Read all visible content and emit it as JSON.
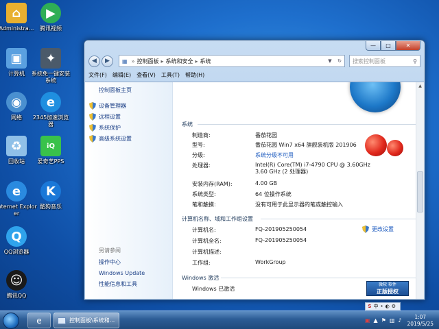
{
  "desktop": {
    "icons": [
      {
        "label": "Administra...",
        "icon": "user-folder-icon",
        "color": "#e8b030"
      },
      {
        "label": "腾讯视频",
        "icon": "tencent-video-icon",
        "color": "#2fae55"
      },
      {
        "label": "计算机",
        "icon": "computer-icon",
        "color": "#5aa0e0"
      },
      {
        "label": "系统免一键安装系统",
        "icon": "install-system-icon",
        "color": "#4b5a6a"
      },
      {
        "label": "网络",
        "icon": "network-icon",
        "color": "#4a90d0"
      },
      {
        "label": "2345加速浏览器",
        "icon": "browser-2345-icon",
        "color": "#1f8fe0"
      },
      {
        "label": "回收站",
        "icon": "recycle-bin-icon",
        "color": "#8fc0e8"
      },
      {
        "label": "爱奇艺PPS",
        "icon": "iqiyi-icon",
        "color": "#39c24a"
      },
      {
        "label": "Internet Explorer",
        "icon": "ie-icon",
        "color": "#2a8ae0"
      },
      {
        "label": "酷狗音乐",
        "icon": "kugou-icon",
        "color": "#1a78d8"
      },
      {
        "label": "QQ浏览器",
        "icon": "qq-browser-icon",
        "color": "#2fa3ec"
      },
      {
        "label": "腾讯QQ",
        "icon": "qq-icon",
        "color": "#1a1a1a"
      }
    ]
  },
  "window": {
    "controls": {
      "minimize": "—",
      "maximize": "□",
      "close": "✕"
    },
    "breadcrumb": [
      "控制面板",
      "系统和安全",
      "系统"
    ],
    "search_placeholder": "搜索控制面板",
    "menu": [
      "文件(F)",
      "编辑(E)",
      "查看(V)",
      "工具(T)",
      "帮助(H)"
    ],
    "sidebar": {
      "home": "控制面板主页",
      "links": [
        "设备管理器",
        "远程设置",
        "系统保护",
        "高级系统设置"
      ],
      "see_also": "另请参阅",
      "also_links": [
        "操作中心",
        "Windows Update",
        "性能信息和工具"
      ]
    },
    "system": {
      "heading": "系统",
      "rows": [
        {
          "k": "制造商:",
          "v": "番茄花园"
        },
        {
          "k": "型号:",
          "v": "番茄花园 Win7 x64 旗舰装机版 201906"
        },
        {
          "k": "分级:",
          "v": "系统分级不可用"
        },
        {
          "k": "处理器:",
          "v": "Intel(R) Core(TM) i7-4790 CPU @ 3.60GHz",
          "v2": "3.60 GHz  (2 处理器)"
        },
        {
          "k": "安装内存(RAM):",
          "v": "4.00 GB"
        },
        {
          "k": "系统类型:",
          "v": "64 位操作系统"
        },
        {
          "k": "笔和触摸:",
          "v": "没有可用于此显示器的笔或触控输入"
        }
      ]
    },
    "computer": {
      "heading": "计算机名称、域和工作组设置",
      "change": "更改设置",
      "rows": [
        {
          "k": "计算机名:",
          "v": "FQ-201905250054"
        },
        {
          "k": "计算机全名:",
          "v": "FQ-201905250054"
        },
        {
          "k": "计算机描述:",
          "v": ""
        },
        {
          "k": "工作组:",
          "v": "WorkGroup"
        }
      ]
    },
    "activation": {
      "heading": "Windows 激活",
      "status": "Windows 已激活",
      "badge_line1": "微软 软件",
      "badge_line2": "正版授权"
    }
  },
  "taskbar": {
    "task_window_label": "控制面板\\系统和...",
    "lang": [
      "中",
      "•",
      "◐",
      "⚙"
    ],
    "time": "1:07",
    "date": "2019/5/25"
  }
}
